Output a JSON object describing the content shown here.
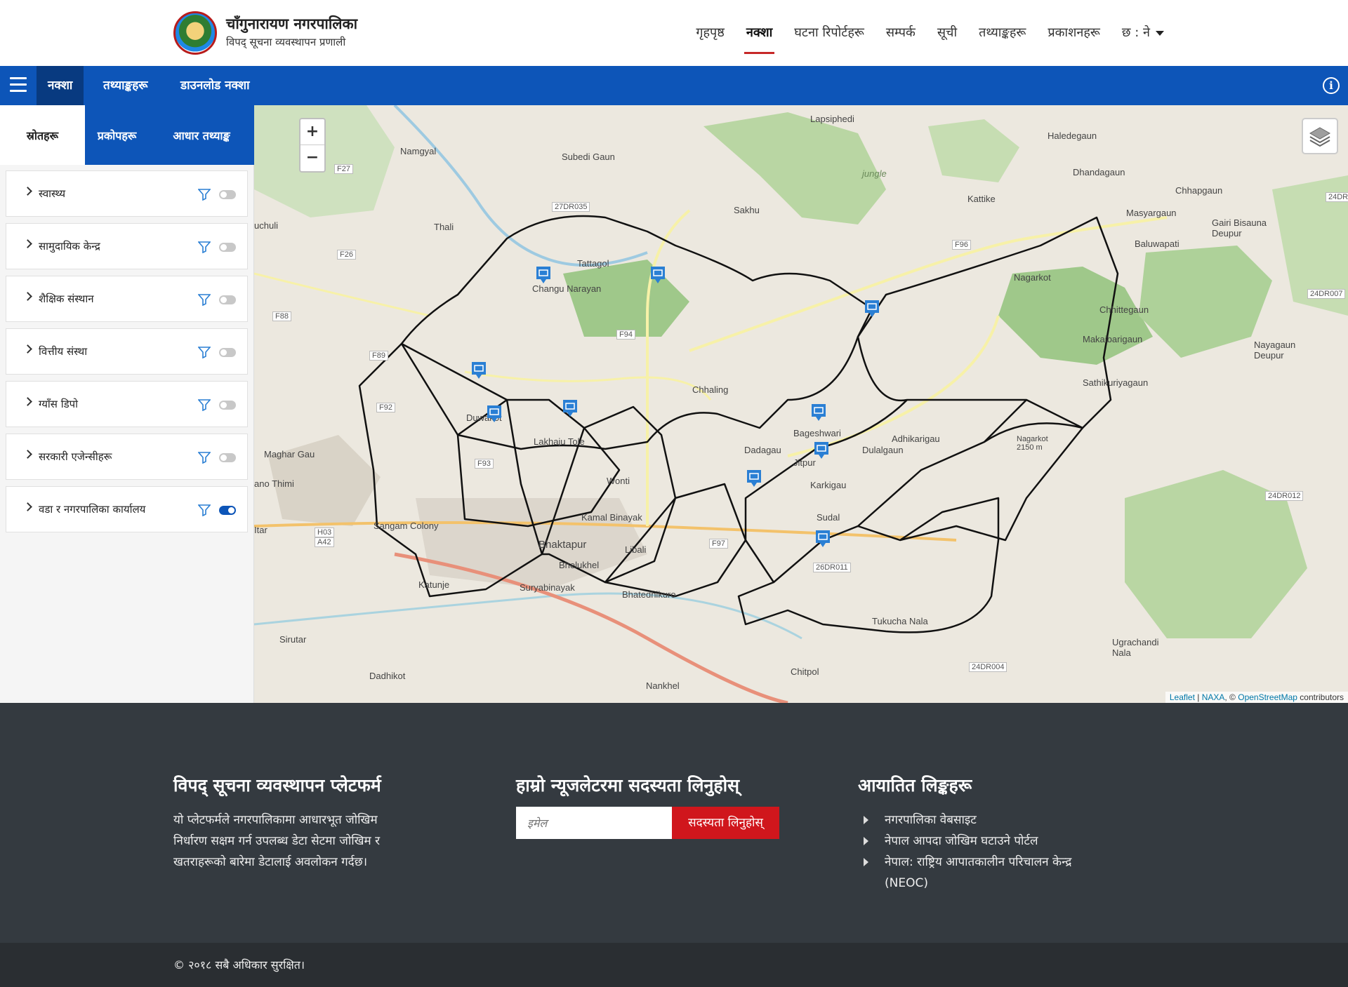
{
  "header": {
    "title": "चाँगुनारायण नगरपालिका",
    "subtitle": "विपद् सूचना व्यवस्थापन प्रणाली",
    "nav": [
      {
        "label": "गृहपृष्ठ"
      },
      {
        "label": "नक्शा",
        "active": true
      },
      {
        "label": "घटना रिपोर्टहरू"
      },
      {
        "label": "सम्पर्क"
      },
      {
        "label": "सूची"
      },
      {
        "label": "तथ्याङ्कहरू"
      },
      {
        "label": "प्रकाशनहरू"
      }
    ],
    "language": "छ : ने"
  },
  "subnav": {
    "tabs": [
      {
        "label": "नक्शा",
        "active": true
      },
      {
        "label": "तथ्याङ्कहरू"
      },
      {
        "label": "डाउनलोड नक्शा"
      }
    ]
  },
  "panel": {
    "tabs": [
      {
        "label": "स्रोतहरू",
        "active": true
      },
      {
        "label": "प्रकोपहरू"
      },
      {
        "label": "आधार तथ्याङ्क"
      }
    ],
    "layers": [
      {
        "label": "स्वास्थ्य",
        "enabled": false
      },
      {
        "label": "सामुदायिक केन्द्र",
        "enabled": false
      },
      {
        "label": "शैक्षिक संस्थान",
        "enabled": false
      },
      {
        "label": "वित्तीय संस्था",
        "enabled": false
      },
      {
        "label": "ग्याँस डिपो",
        "enabled": false
      },
      {
        "label": "सरकारी एजेन्सीहरू",
        "enabled": false
      },
      {
        "label": "वडा र नगरपालिका कार्यालय",
        "enabled": true
      }
    ]
  },
  "map": {
    "zoom_in": "+",
    "zoom_out": "−",
    "attribution": {
      "leaflet": "Leaflet",
      "naxa": "NAXA",
      "osm": "OpenStreetMap",
      "suffix": "contributors"
    },
    "places": [
      "Lapsiphedi",
      "Haledegaun",
      "Namgyal",
      "Subedi Gaun",
      "Dhandagaun",
      "Chhapgaun",
      "Kattike",
      "Gairi Bisauna Deupur",
      "Masyargaun",
      "Baluwapati",
      "Sakhu",
      "Thali",
      "Tattagol",
      "Nagarkot",
      "Changu Narayan",
      "Chhittegaun",
      "Makaibarigaun",
      "Nayagaun Deupur",
      "Chhaling",
      "Sathikuriyagaun",
      "Duwakot",
      "Lakhaju Tole",
      "Bageshwari",
      "Adhikarigau",
      "Dadagau",
      "Jitpur",
      "Dulalgaun",
      "Karkigau",
      "Wonti",
      "Kamal Binayak",
      "Sudal",
      "Sangam Colony",
      "Bhaktapur",
      "Libali",
      "Bhelukhel",
      "Katunje",
      "Suryabinayak",
      "Bhatedhikuro",
      "Tukucha Nala",
      "Ugrachandi Nala",
      "Sirutar",
      "Dadhikot",
      "Chitpol",
      "Nankhel",
      "Maghar Gau",
      "ano Thimi",
      "Itar",
      "uchuli",
      "jungle",
      "Nagarkot 2150 m"
    ],
    "roads": [
      "F27",
      "27DR035",
      "F26",
      "F88",
      "F89",
      "F92",
      "F93",
      "F94",
      "F96",
      "F97",
      "26DR011",
      "24DR007",
      "24DR012",
      "24DR004",
      "24DR",
      "H03",
      "A42"
    ]
  },
  "footer": {
    "about_title": "विपद् सूचना व्यवस्थापन प्लेटफर्म",
    "about_text": "यो प्लेटफर्मले नगरपालिकामा आधारभूत जोखिम निर्धारण सक्षम गर्न उपलब्ध डेटा सेटमा जोखिम र खतराहरूको बारेमा डेटालाई अवलोकन गर्दछ।",
    "newsletter_title": "हाम्रो न्यूजलेटरमा सदस्यता लिनुहोस्",
    "email_placeholder": "इमेल",
    "subscribe_label": "सदस्यता लिनुहोस्",
    "links_title": "आयातित लिङ्कहरू",
    "links": [
      "नगरपालिका वेबसाइट",
      "नेपाल आपदा जोखिम घटाउने पोर्टल",
      "नेपाल: राष्ट्रिय आपातकालीन परिचालन केन्द्र (NEOC)"
    ],
    "copyright": "© २०१८   सबै अधिकार सुरक्षित।"
  }
}
